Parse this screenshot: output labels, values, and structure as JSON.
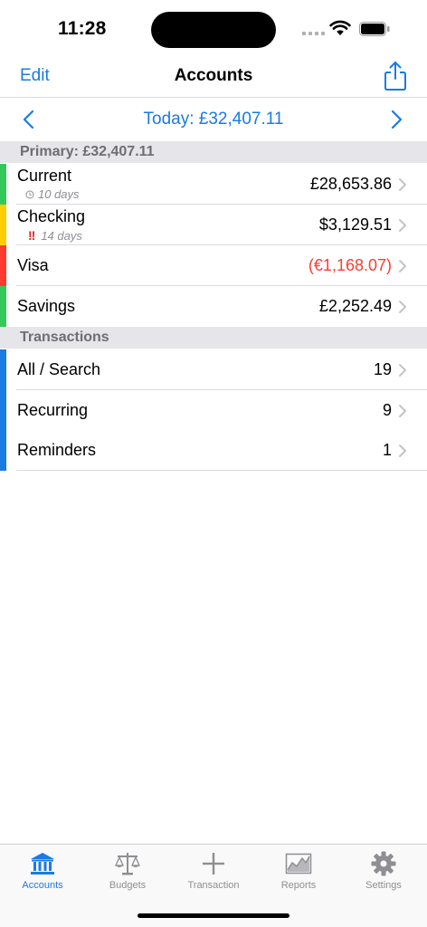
{
  "status": {
    "time": "11:28"
  },
  "nav": {
    "edit_label": "Edit",
    "title": "Accounts",
    "share_icon": "share-icon"
  },
  "date_bar": {
    "label": "Today: £32,407.11"
  },
  "sections": {
    "primary": {
      "header": "Primary: £32,407.11"
    },
    "transactions": {
      "header": "Transactions"
    }
  },
  "accounts": [
    {
      "name": "Current",
      "sub": "10 days",
      "sub_icon": "clock-icon",
      "value": "£28,653.86",
      "color": "#34c759",
      "negative": false
    },
    {
      "name": "Checking",
      "sub": "14 days",
      "sub_icon": "alert-icon",
      "sub_mark": "!!",
      "value": "$3,129.51",
      "color": "#ffcc00",
      "negative": false
    },
    {
      "name": "Visa",
      "value": "(€1,168.07)",
      "color": "#ff3b30",
      "negative": true
    },
    {
      "name": "Savings",
      "value": "£2,252.49",
      "color": "#34c759",
      "negative": false
    }
  ],
  "transaction_rows": [
    {
      "name": "All / Search",
      "value": "19",
      "color": "#1b7ae3"
    },
    {
      "name": "Recurring",
      "value": "9",
      "color": "#1b7ae3"
    },
    {
      "name": "Reminders",
      "value": "1",
      "color": "#1b7ae3"
    }
  ],
  "tabs": [
    {
      "label": "Accounts",
      "icon": "bank-icon",
      "active": true
    },
    {
      "label": "Budgets",
      "icon": "scale-icon",
      "active": false
    },
    {
      "label": "Transaction",
      "icon": "plus-icon",
      "active": false
    },
    {
      "label": "Reports",
      "icon": "chart-icon",
      "active": false
    },
    {
      "label": "Settings",
      "icon": "gear-icon",
      "active": false
    }
  ],
  "colors": {
    "accent": "#1b7ae3",
    "negative": "#ff3b30",
    "muted": "#8e8e93"
  }
}
